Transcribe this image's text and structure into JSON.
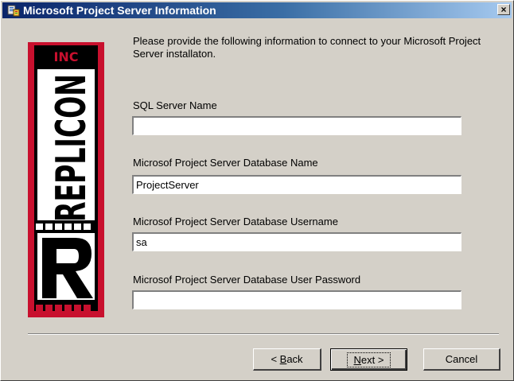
{
  "window": {
    "title": "Microsoft Project Server Information",
    "close_glyph": "×"
  },
  "logo": {
    "top_text": "INC",
    "brand_text": "REPLICON",
    "letter": "R",
    "colors": {
      "red": "#c8102e",
      "black": "#000000",
      "white": "#ffffff"
    }
  },
  "form": {
    "intro": "Please provide the following information to connect to your Microsoft Project Server installaton.",
    "fields": [
      {
        "label": "SQL Server Name",
        "value": ""
      },
      {
        "label": "Microsof Project Server Database Name",
        "value": "ProjectServer"
      },
      {
        "label": "Microsof Project Server Database Username",
        "value": "sa"
      },
      {
        "label": "Microsof Project Server Database User Password",
        "value": ""
      }
    ]
  },
  "buttons": {
    "back_prefix": "< ",
    "back_accel": "B",
    "back_rest": "ack",
    "next_accel": "N",
    "next_rest": "ext >",
    "cancel": "Cancel"
  }
}
